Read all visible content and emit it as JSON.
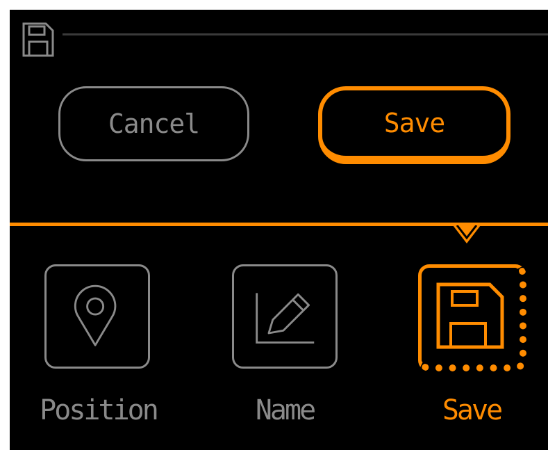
{
  "header": {
    "icon": "floppy-disk-icon"
  },
  "dialog": {
    "cancel_label": "Cancel",
    "save_label": "Save"
  },
  "menu": {
    "selected_index": 2,
    "items": [
      {
        "label": "Position",
        "icon": "map-pin-icon"
      },
      {
        "label": "Name",
        "icon": "pencil-icon"
      },
      {
        "label": "Save",
        "icon": "floppy-disk-icon"
      }
    ]
  },
  "colors": {
    "accent": "#ff8c00",
    "inactive": "#8a8a8a",
    "background": "#000000"
  }
}
